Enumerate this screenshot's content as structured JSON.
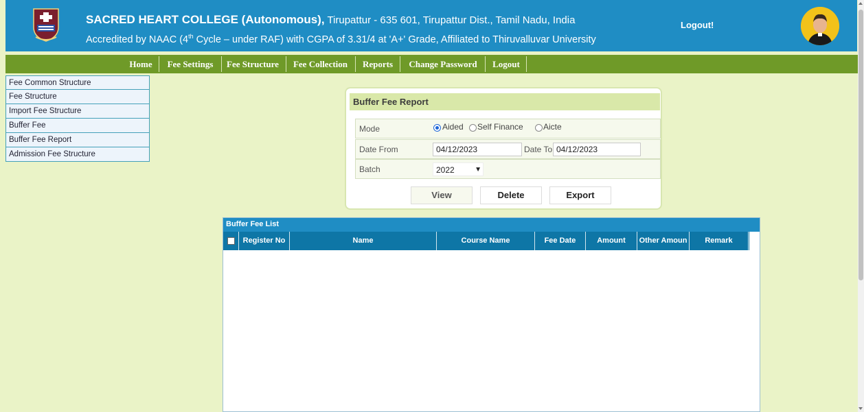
{
  "header": {
    "college_name": "SACRED HEART COLLEGE (Autonomous),",
    "address": " Tirupattur - 635 601, Tirupattur Dist., Tamil Nadu, India",
    "accred_pre": "Accredited by NAAC (4",
    "accred_sup": "th",
    "accred_post": " Cycle – under RAF) with CGPA of 3.31/4 at 'A+' Grade, Affiliated to Thiruvalluvar University",
    "logout_link": "Logout!"
  },
  "nav": {
    "items": [
      "Home",
      "Fee Settings",
      "Fee Structure",
      "Fee Collection",
      "Reports",
      "Change Password",
      "Logout"
    ]
  },
  "sidebar": {
    "items": [
      "Fee Common Structure",
      "Fee Structure",
      "Import Fee Structure",
      "Buffer Fee",
      "Buffer Fee Report",
      "Admission Fee Structure"
    ]
  },
  "report": {
    "title": "Buffer Fee Report",
    "mode_label": "Mode",
    "mode_options": [
      "Aided",
      "Self Finance",
      "Aicte"
    ],
    "mode_selected": "Aided",
    "date_from_label": "Date From",
    "date_from_value": "04/12/2023",
    "date_to_label": "Date To",
    "date_to_value": "04/12/2023",
    "batch_label": "Batch",
    "batch_value": "2022",
    "view_label": "View",
    "delete_label": "Delete",
    "export_label": "Export"
  },
  "list": {
    "title": "Buffer Fee List",
    "columns": [
      "Register No",
      "Name",
      "Course Name",
      "Fee Date",
      "Amount",
      "Other Amoun",
      "Remark"
    ]
  },
  "colors": {
    "header_blue": "#1f8dc4",
    "nav_green": "#6f9a28",
    "page_bg": "#eaf3c7",
    "table_header": "#0e76a6"
  }
}
